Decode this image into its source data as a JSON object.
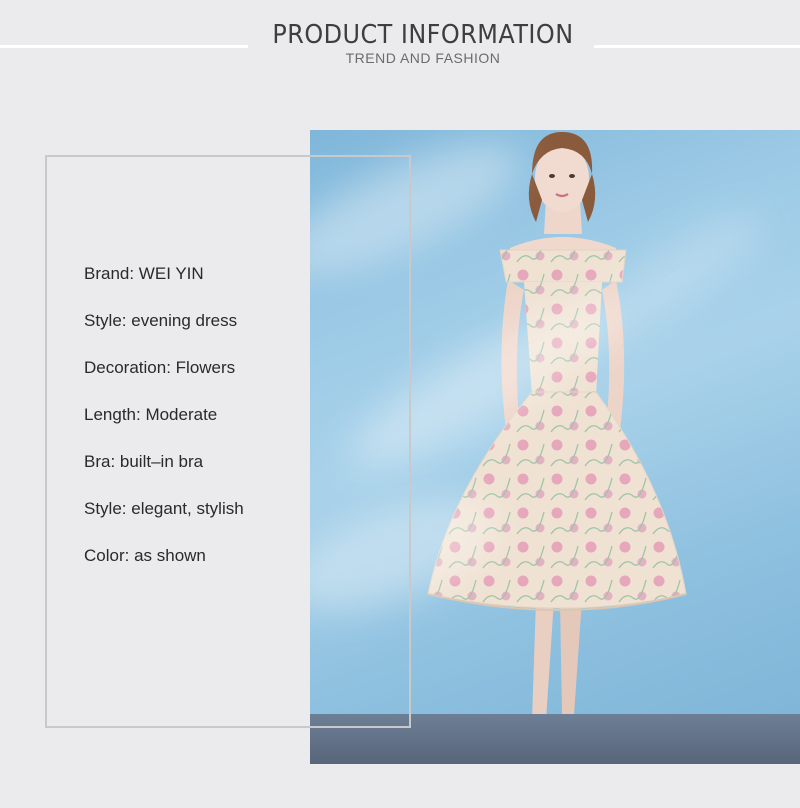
{
  "header": {
    "title": "PRODUCT INFORMATION",
    "subtitle": "TREND AND FASHION"
  },
  "specs": [
    "Brand: WEI YIN",
    "Style: evening dress",
    "Decoration: Flowers",
    "Length: Moderate",
    "Bra: built–in bra",
    "Style: elegant, stylish",
    "Color: as shown"
  ],
  "colors": {
    "background": "#ebebee",
    "text": "#2a2a2a",
    "frame": "#c9c9cc",
    "backdrop_blue": "#9ccae6",
    "dress": "#f0e4d6",
    "flower_pink": "#e8a9bd"
  }
}
